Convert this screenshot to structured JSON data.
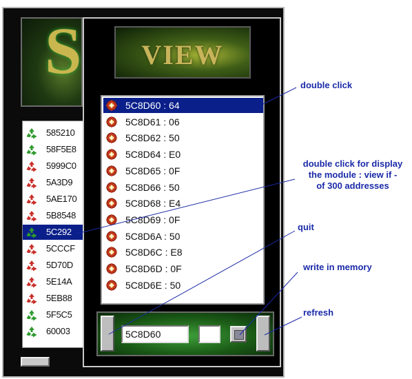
{
  "front_window": {
    "banner_text": "VIEW",
    "list_items": [
      {
        "label": "5C8D60 : 64",
        "selected": true
      },
      {
        "label": "5C8D61 : 06",
        "selected": false
      },
      {
        "label": "5C8D62 : 50",
        "selected": false
      },
      {
        "label": "5C8D64 : E0",
        "selected": false
      },
      {
        "label": "5C8D65 : 0F",
        "selected": false
      },
      {
        "label": "5C8D66 : 50",
        "selected": false
      },
      {
        "label": "5C8D68 : E4",
        "selected": false
      },
      {
        "label": "5C8D69 : 0F",
        "selected": false
      },
      {
        "label": "5C8D6A : 50",
        "selected": false
      },
      {
        "label": "5C8D6C : E8",
        "selected": false
      },
      {
        "label": "5C8D6D : 0F",
        "selected": false
      },
      {
        "label": "5C8D6E : 50",
        "selected": false
      }
    ],
    "address_value": "5C8D60",
    "value_field": ""
  },
  "back_window": {
    "banner_letter": "S",
    "list_items": [
      {
        "label": "585210",
        "icon": "recycle-green-icon",
        "selected": false
      },
      {
        "label": "58F5E8",
        "icon": "recycle-green-icon",
        "selected": false
      },
      {
        "label": "5999C0",
        "icon": "recycle-red-icon",
        "selected": false
      },
      {
        "label": "5A3D9",
        "icon": "recycle-red-icon",
        "selected": false
      },
      {
        "label": "5AE170",
        "icon": "recycle-red-icon",
        "selected": false
      },
      {
        "label": "5B8548",
        "icon": "recycle-red-icon",
        "selected": false
      },
      {
        "label": "5C292",
        "icon": "recycle-green-icon",
        "selected": true
      },
      {
        "label": "5CCCF",
        "icon": "recycle-red-icon",
        "selected": false
      },
      {
        "label": "5D70D",
        "icon": "recycle-red-icon",
        "selected": false
      },
      {
        "label": "5E14A",
        "icon": "recycle-red-icon",
        "selected": false
      },
      {
        "label": "5EB88",
        "icon": "recycle-red-icon",
        "selected": false
      },
      {
        "label": "5F5C5",
        "icon": "recycle-green-icon",
        "selected": false
      },
      {
        "label": "60003",
        "icon": "recycle-green-icon",
        "selected": false
      }
    ]
  },
  "annotations": {
    "double_click": "double click",
    "double_click_display_lines": [
      "double click for display",
      "the module : view if -",
      "of 300 addresses"
    ],
    "quit": "quit",
    "write_in_memory": "write in memory",
    "refresh": "refresh"
  },
  "colors": {
    "selection": "#0a1f8a",
    "annotation": "#1a2aa8",
    "window_bg": "#000000"
  }
}
